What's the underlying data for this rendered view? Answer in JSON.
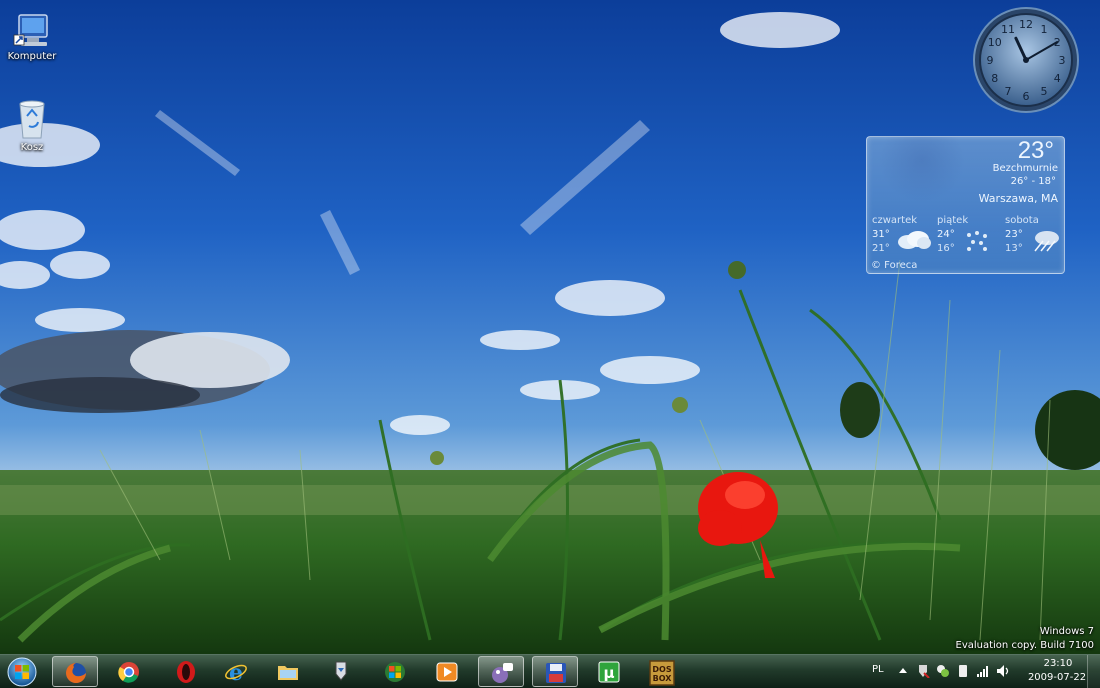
{
  "desktop": {
    "icons": [
      {
        "label": "Komputer",
        "icon": "computer-icon"
      },
      {
        "label": "Kosz",
        "icon": "recycle-bin-icon"
      }
    ]
  },
  "gadgets": {
    "clock": {
      "hour": 11,
      "minute": 10,
      "numbers": [
        "12",
        "1",
        "2",
        "3",
        "4",
        "5",
        "6",
        "7",
        "8",
        "9",
        "10",
        "11"
      ]
    },
    "weather": {
      "temperature": "23°",
      "condition": "Bezchmurnie",
      "range": "26° - 18°",
      "city": "Warszawa, MA",
      "forecast": [
        {
          "day": "czwartek",
          "high": "31°",
          "low": "21°",
          "icon": "cloudy-icon"
        },
        {
          "day": "piątek",
          "high": "24°",
          "low": "16°",
          "icon": "rain-icon"
        },
        {
          "day": "sobota",
          "high": "23°",
          "low": "13°",
          "icon": "storm-icon"
        }
      ],
      "source": "© Foreca"
    }
  },
  "watermark": {
    "line1": "Windows 7",
    "line2": "Evaluation copy. Build 7100"
  },
  "taskbar": {
    "pinned": [
      {
        "name": "firefox",
        "active": true
      },
      {
        "name": "chrome",
        "active": false
      },
      {
        "name": "opera",
        "active": false
      },
      {
        "name": "internet-explorer",
        "active": false
      },
      {
        "name": "explorer",
        "active": false
      },
      {
        "name": "download-manager",
        "active": false
      },
      {
        "name": "media-center",
        "active": false
      },
      {
        "name": "media-player",
        "active": false
      },
      {
        "name": "pidgin",
        "active": false
      },
      {
        "name": "save-app",
        "active": false
      },
      {
        "name": "utorrent",
        "active": false
      },
      {
        "name": "dosbox",
        "active": false
      }
    ],
    "tray": {
      "language": "PL",
      "time": "23:10",
      "date": "2009-07-22"
    }
  }
}
